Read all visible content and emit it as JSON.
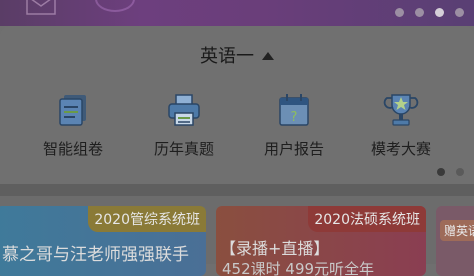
{
  "carousel": {
    "page_count": 4,
    "active_index": 2
  },
  "subject_selector": {
    "label": "英语一",
    "icon": "caret-up-icon"
  },
  "features": [
    {
      "label": "智能组卷",
      "icon": "document-stack-icon"
    },
    {
      "label": "历年真题",
      "icon": "printer-icon"
    },
    {
      "label": "用户报告",
      "icon": "calendar-question-icon"
    },
    {
      "label": "模考大赛",
      "icon": "trophy-icon"
    }
  ],
  "feature_pager": {
    "page_count": 2,
    "active_index": 0
  },
  "courses": [
    {
      "tag": "2020管综系统班",
      "title": "慕之哥与汪老师强强联手"
    },
    {
      "tag": "2020法硕系统班",
      "title": "【录播+直播】",
      "subtitle": "452课时 499元听全年"
    },
    {
      "tag": "赠英语"
    }
  ],
  "colors": {
    "accent_blue": "#2b6aa8",
    "accent_orange": "#e8a53a",
    "accent_red": "#c84a3a"
  }
}
